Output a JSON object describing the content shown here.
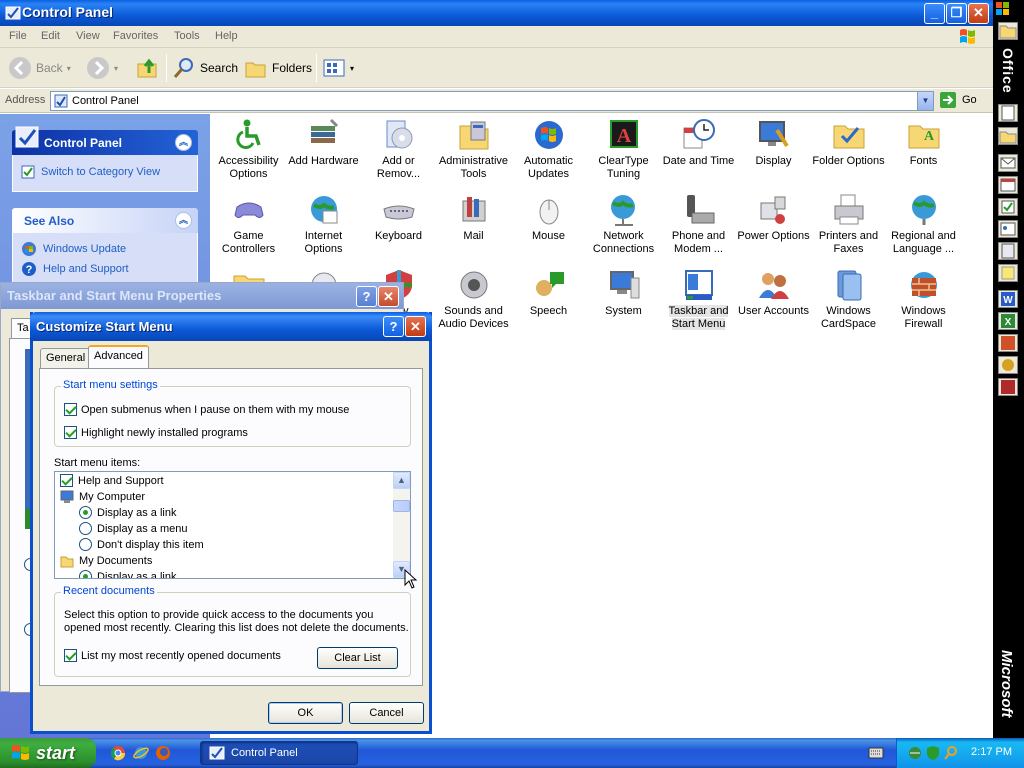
{
  "window": {
    "title": "Control Panel"
  },
  "menu": [
    "File",
    "Edit",
    "View",
    "Favorites",
    "Tools",
    "Help"
  ],
  "toolbar": {
    "back": "Back",
    "search": "Search",
    "folders": "Folders"
  },
  "address": {
    "label": "Address",
    "value": "Control Panel",
    "go": "Go"
  },
  "taskpane": {
    "panel_title": "Control Panel",
    "switch_view": "Switch to Category View",
    "see_also_title": "See Also",
    "see_also": [
      "Windows Update",
      "Help and Support"
    ]
  },
  "items": [
    [
      "Accessibility",
      "Options"
    ],
    [
      "Add Hardware",
      ""
    ],
    [
      "Add or",
      "Remov..."
    ],
    [
      "Administrative",
      "Tools"
    ],
    [
      "Automatic",
      "Updates"
    ],
    [
      "ClearType",
      "Tuning"
    ],
    [
      "Date and Time",
      ""
    ],
    [
      "Display",
      ""
    ],
    [
      "Folder Options",
      ""
    ],
    [
      "Fonts",
      ""
    ],
    [
      "Game",
      "Controllers"
    ],
    [
      "Internet",
      "Options"
    ],
    [
      "Keyboard",
      ""
    ],
    [
      "Mail",
      ""
    ],
    [
      "Mouse",
      ""
    ],
    [
      "Network",
      "Connections"
    ],
    [
      "Phone and",
      "Modem ..."
    ],
    [
      "Power Options",
      ""
    ],
    [
      "Printers and",
      "Faxes"
    ],
    [
      "Regional and",
      "Language ..."
    ],
    [
      "",
      ""
    ],
    [
      "",
      ""
    ],
    [
      "...ity",
      ""
    ],
    [
      "Sounds and",
      "Audio Devices"
    ],
    [
      "Speech",
      ""
    ],
    [
      "System",
      ""
    ],
    [
      "Taskbar and",
      "Start Menu"
    ],
    [
      "User Accounts",
      ""
    ],
    [
      "Windows",
      "CardSpace"
    ],
    [
      "Windows",
      "Firewall"
    ]
  ],
  "officebar": {
    "title": "Office",
    "brand": "Microsoft"
  },
  "tsmp": {
    "title": "Taskbar and Start Menu Properties",
    "tab_fragment": "Ta"
  },
  "csm": {
    "title": "Customize Start Menu",
    "tabs": [
      "General",
      "Advanced"
    ],
    "settings_group": "Start menu settings",
    "settings": [
      {
        "label": "Open submenus when I pause on them with my mouse",
        "checked": true
      },
      {
        "label": "Highlight newly installed programs",
        "checked": true
      }
    ],
    "items_label": "Start menu items:",
    "list": [
      {
        "type": "check",
        "label": "Help and Support",
        "checked": true,
        "indent": 0
      },
      {
        "type": "icon",
        "label": "My Computer",
        "indent": 0
      },
      {
        "type": "radio",
        "label": "Display as a link",
        "checked": true,
        "indent": 1
      },
      {
        "type": "radio",
        "label": "Display as a menu",
        "checked": false,
        "indent": 1
      },
      {
        "type": "radio",
        "label": "Don't display this item",
        "checked": false,
        "indent": 1
      },
      {
        "type": "icon",
        "label": "My Documents",
        "indent": 0
      },
      {
        "type": "radio",
        "label": "Display as a link",
        "checked": true,
        "indent": 1
      }
    ],
    "recent_group": "Recent documents",
    "recent_desc_1": "Select this option to provide quick access to the documents you",
    "recent_desc_2": "opened most recently.  Clearing this list does not delete the documents.",
    "recent_check": "List my most recently opened documents",
    "clear_list": "Clear List",
    "ok": "OK",
    "cancel": "Cancel"
  },
  "taskbar": {
    "start": "start",
    "task": "Control Panel",
    "clock": "2:17 PM"
  }
}
